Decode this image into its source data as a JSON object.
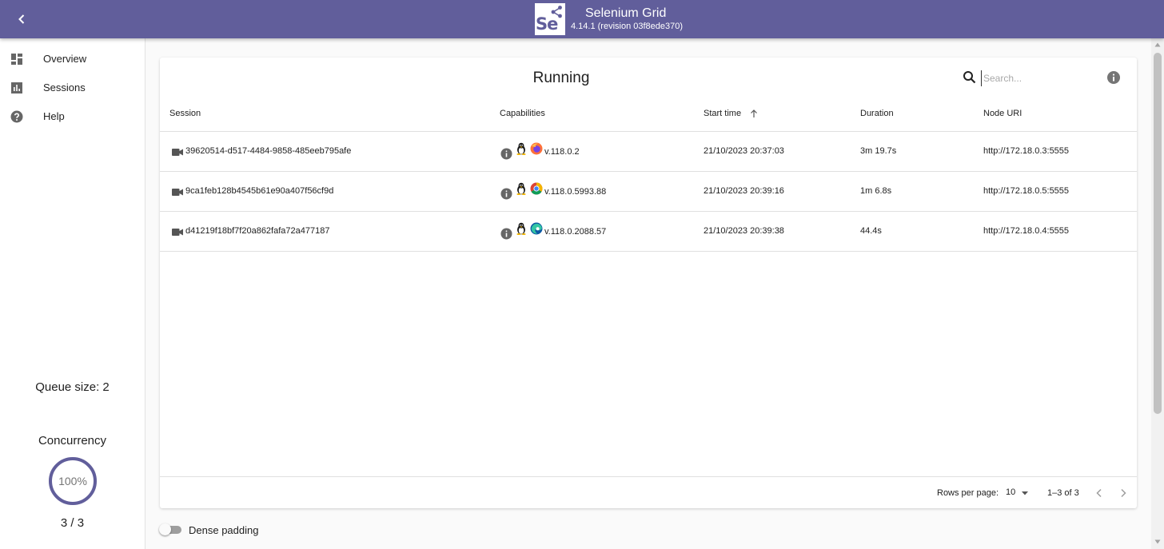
{
  "colors": {
    "brand": "#615e9b",
    "header_text": "#ffffff"
  },
  "appbar": {
    "back_icon": "arrow-back-icon",
    "logo_text": "Se",
    "title": "Selenium Grid",
    "version": "4.14.1 (revision 03f8ede370)"
  },
  "sidebar": {
    "items": [
      {
        "label": "Overview",
        "icon": "dashboard-icon"
      },
      {
        "label": "Sessions",
        "icon": "bar-chart-icon"
      },
      {
        "label": "Help",
        "icon": "help-icon"
      }
    ],
    "queue_size": "Queue size: 2",
    "concurrency_label": "Concurrency",
    "concurrency_percent": "100%",
    "concurrency_fraction": 1.0,
    "concurrency_count": "3 / 3"
  },
  "main": {
    "title": "Running",
    "search": {
      "placeholder": "Search...",
      "value": ""
    },
    "columns": {
      "session": "Session",
      "capabilities": "Capabilities",
      "start_time": "Start time",
      "duration": "Duration",
      "node_uri": "Node URI"
    },
    "sort": {
      "column": "Start time",
      "direction": "ascending",
      "icon": "arrow-up-icon"
    },
    "rows": [
      {
        "session": "39620514-d517-4484-9858-485eeb795afe",
        "os": "linux-icon",
        "browser": "firefox-icon",
        "version": "v.118.0.2",
        "start_time": "21/10/2023 20:37:03",
        "duration": "3m 19.7s",
        "node_uri": "http://172.18.0.3:5555"
      },
      {
        "session": "9ca1feb128b4545b61e90a407f56cf9d",
        "os": "linux-icon",
        "browser": "chrome-icon",
        "version": "v.118.0.5993.88",
        "start_time": "21/10/2023 20:39:16",
        "duration": "1m 6.8s",
        "node_uri": "http://172.18.0.5:5555"
      },
      {
        "session": "d41219f18bf7f20a862fafa72a477187",
        "os": "linux-icon",
        "browser": "edge-icon",
        "version": "v.118.0.2088.57",
        "start_time": "21/10/2023 20:39:38",
        "duration": "44.4s",
        "node_uri": "http://172.18.0.4:5555"
      }
    ],
    "pagination": {
      "rows_per_page_label": "Rows per page:",
      "rows_per_page_value": "10",
      "range": "1–3 of 3"
    }
  },
  "dense_padding": {
    "label": "Dense padding",
    "enabled": false
  }
}
